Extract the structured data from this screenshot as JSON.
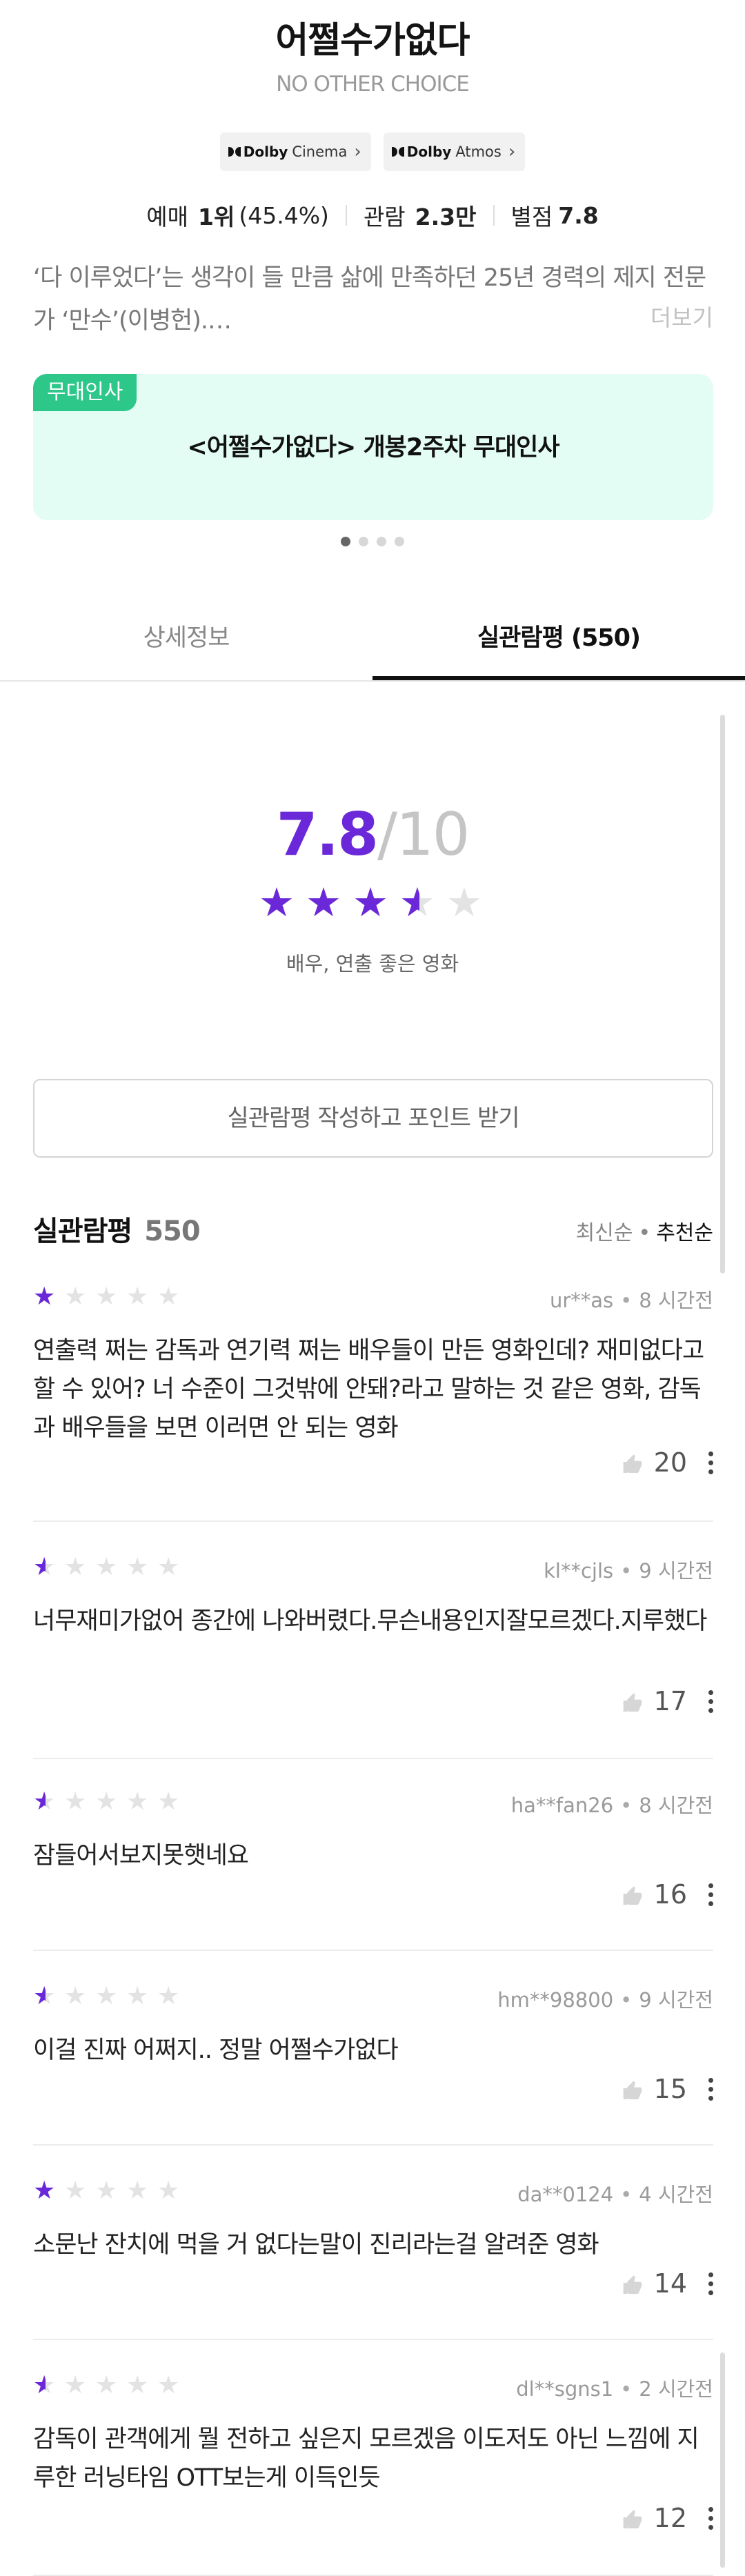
{
  "movie": {
    "title": "어쩔수가없다",
    "subtitle": "NO OTHER CHOICE",
    "badges": [
      {
        "brand": "Dolby",
        "product": "Cinema"
      },
      {
        "brand": "Dolby",
        "product": "Atmos"
      }
    ],
    "stats": {
      "booking_label": "예매",
      "booking_rank": "1위",
      "booking_pct": "(45.4%)",
      "audience_label": "관람",
      "audience_value": "2.3만",
      "rating_label": "별점",
      "rating_value": "7.8"
    },
    "synopsis": "‘다 이루었다’는 생각이 들 만큼 삶에 만족하던 25년 경력의 제지 전문가 ‘만수’(이병헌).…",
    "more_label": "더보기"
  },
  "banner": {
    "tag": "무대인사",
    "text": "<어쩔수가없다> 개봉2주차 무대인사",
    "page_count": 4,
    "active_page": 1
  },
  "tabs": [
    {
      "label": "상세정보",
      "active": false
    },
    {
      "label": "실관람평 (550)",
      "active": true
    }
  ],
  "rating_summary": {
    "score": "7.8",
    "denominator": "/10",
    "stars": 3.5,
    "tagline": "배우, 연출 좋은 영화",
    "write_button": "실관람평 작성하고 포인트 받기"
  },
  "reviews_header": {
    "title": "실관람평",
    "count": "550",
    "sort_options": [
      "최신순",
      "추천순"
    ],
    "sort_active": "추천순"
  },
  "colors": {
    "accent": "#6a28d9",
    "banner_bg": "#e3fdf4",
    "banner_tag": "#2ec78a"
  },
  "reviews": [
    {
      "stars": 1,
      "user": "ur**as",
      "time": "8 시간전",
      "text": "연출력 쩌는 감독과 연기력 쩌는 배우들이 만든 영화인데? 재미없다고 할 수 있어? 너 수준이 그것밖에 안돼?라고 말하는 것 같은 영화, 감독과 배우들을 보면 이러면 안 되는 영화",
      "likes": "20"
    },
    {
      "stars": 0.5,
      "user": "kl**cjls",
      "time": "9 시간전",
      "text": "너무재미가없어 종간에 나와버렸다.무슨내용인지잘모르겠다.지루했다",
      "likes": "17"
    },
    {
      "stars": 0.5,
      "user": "ha**fan26",
      "time": "8 시간전",
      "text": "잠들어서보지못햇네요",
      "likes": "16"
    },
    {
      "stars": 0.5,
      "user": "hm**98800",
      "time": "9 시간전",
      "text": "이걸 진짜 어쩌지.. 정말 어쩔수가없다",
      "likes": "15"
    },
    {
      "stars": 1,
      "user": "da**0124",
      "time": "4 시간전",
      "text": "소문난 잔치에 먹을 거 없다는말이 진리라는걸 알려준 영화",
      "likes": "14"
    },
    {
      "stars": 0.5,
      "user": "dl**sgns1",
      "time": "2 시간전",
      "text": "감독이 관객에게 뭘 전하고 싶은지 모르겠음 이도저도 아닌 느낌에 지루한 러닝타임 OTT보는게 이득인듯",
      "likes": "12"
    }
  ]
}
